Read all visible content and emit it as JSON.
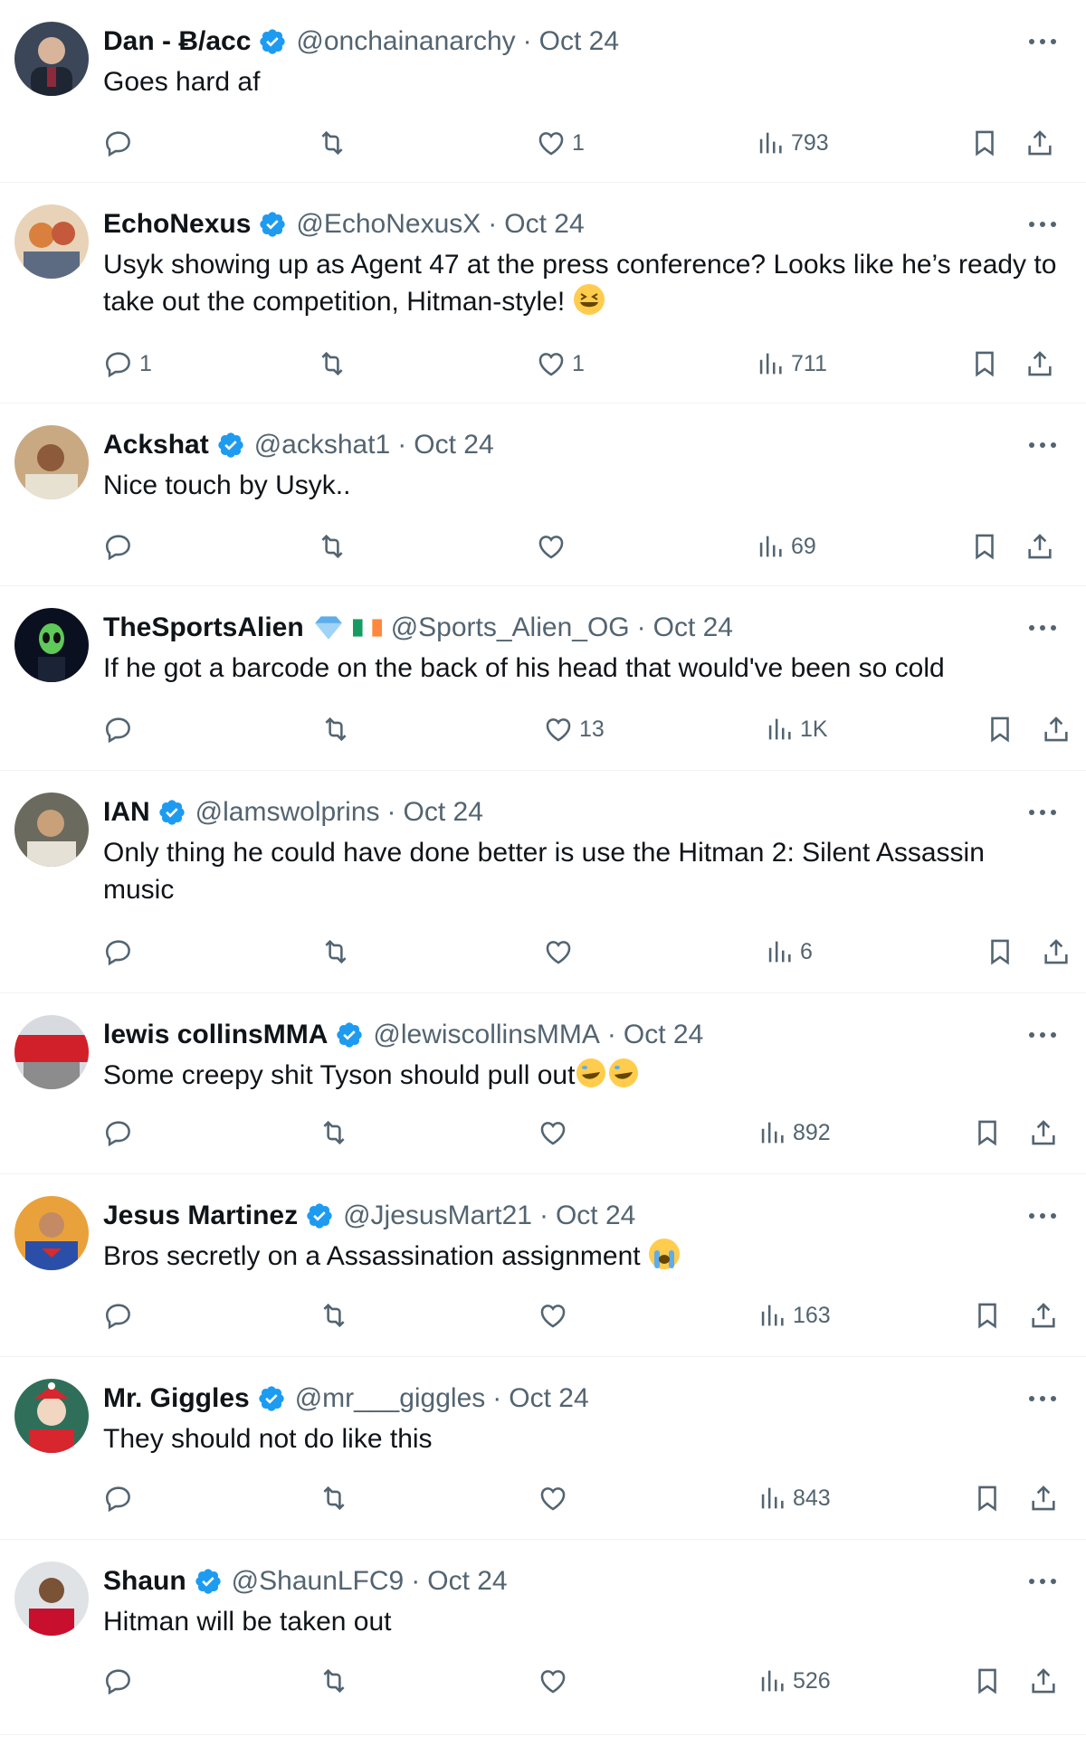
{
  "icons": {
    "reply": "reply-icon",
    "retweet": "retweet-icon",
    "like": "heart-icon",
    "views": "views-icon",
    "bookmark": "bookmark-icon",
    "share": "share-icon",
    "more": "more-icon",
    "verified": "verified-badge-icon"
  },
  "colors": {
    "verified": "#1d9bf0",
    "secondary_text": "#536471",
    "text": "#0f1419",
    "divider": "#eff3f4"
  },
  "tweets": [
    {
      "name": "Dan - Ƀ/acc",
      "handle": "@onchainanarchy",
      "date": "Oct 24",
      "text": "Goes hard af",
      "replies": "",
      "likes": "1",
      "views": "793"
    },
    {
      "name": "EchoNexus",
      "handle": "@EchoNexusX",
      "date": "Oct 24",
      "text": "Usyk showing up as Agent 47 at the press conference? Looks like he’s ready to take out the competition, Hitman-style!",
      "emoji": "grinning-squinting-face",
      "replies": "1",
      "likes": "1",
      "views": "711"
    },
    {
      "name": "Ackshat",
      "handle": "@ackshat1",
      "date": "Oct 24",
      "text": "Nice touch by Usyk..",
      "replies": "",
      "likes": "",
      "views": "69"
    },
    {
      "name": "TheSportsAlien",
      "handle": "@Sports_Alien_OG",
      "date": "Oct 24",
      "text": "If he got a barcode on the back of his head that would've been so cold",
      "name_emojis": [
        "blue-diamond",
        "ireland-flag"
      ],
      "replies": "",
      "likes": "13",
      "views": "1K"
    },
    {
      "name": "IAN",
      "handle": "@lamswolprins",
      "date": "Oct 24",
      "text": "Only thing he could have done better is use the Hitman 2: Silent Assassin music",
      "replies": "",
      "likes": "",
      "views": "6"
    },
    {
      "name": "lewis collinsMMA",
      "handle": "@lewiscollinsMMA",
      "date": "Oct 24",
      "text": "Some creepy shit Tyson should pull out",
      "emoji": "rolling-on-floor-laughing x2",
      "replies": "",
      "likes": "",
      "views": "892"
    },
    {
      "name": "Jesus Martinez",
      "handle": "@JjesusMart21",
      "date": "Oct 24",
      "text": "Bros secretly on a Assassination assignment",
      "emoji": "loudly-crying-face",
      "replies": "",
      "likes": "",
      "views": "163"
    },
    {
      "name": "Mr. Giggles",
      "handle": "@mr___giggles",
      "date": "Oct 24",
      "text": "They should not do like this",
      "replies": "",
      "likes": "",
      "views": "843"
    },
    {
      "name": "Shaun",
      "handle": "@ShaunLFC9",
      "date": "Oct 24",
      "text": "Hitman will be taken out",
      "replies": "",
      "likes": "",
      "views": "526"
    }
  ]
}
